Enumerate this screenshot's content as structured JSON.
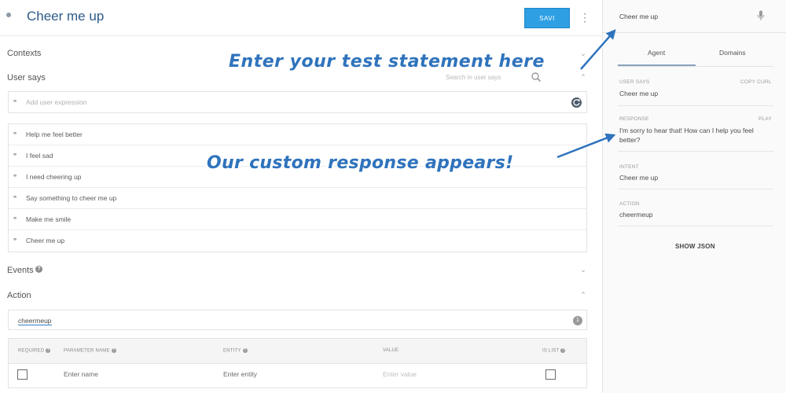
{
  "header": {
    "title": "Cheer me up",
    "save_label": "SAVI"
  },
  "contexts": {
    "title": "Contexts"
  },
  "user_says": {
    "title": "User says",
    "search_placeholder": "Search in user says",
    "add_placeholder": "Add user expression",
    "expressions": [
      "Help me feel better",
      "I feel sad",
      "I need cheering up",
      "Say something to cheer me up",
      "Make me smile",
      "Cheer me up"
    ]
  },
  "events": {
    "title": "Events"
  },
  "action": {
    "title": "Action",
    "value": "cheermeup",
    "count": "1"
  },
  "parameters": {
    "headers": {
      "required": "REQUIRED",
      "name": "PARAMETER NAME",
      "entity": "ENTITY",
      "value": "VALUE",
      "is_list": "IS LIST"
    },
    "row": {
      "name_placeholder": "Enter name",
      "entity_placeholder": "Enter entity",
      "value_placeholder": "Enter value"
    }
  },
  "console": {
    "query": "Cheer me up",
    "tabs": [
      "Agent",
      "Domains"
    ],
    "active_tab": "Agent",
    "user_says_label": "USER SAYS",
    "copy_curl": "COPY CURL",
    "user_says_value": "Cheer me up",
    "response_label": "RESPONSE",
    "play": "PLAY",
    "response_line1": "I'm sorry to hear that! How can I help you feel",
    "response_line2": "better?",
    "intent_label": "INTENT",
    "intent_value": "Cheer me up",
    "action_label": "ACTION",
    "action_value": "cheermeup",
    "show_json": "SHOW JSON"
  },
  "annotations": {
    "test_statement": "Enter your test statement here",
    "custom_response": "Our custom response appears!"
  },
  "colors": {
    "accent": "#2e9fe3",
    "title": "#2d5b8a",
    "annotation": "#2f73bc"
  },
  "icons": [
    "dot-icon",
    "kebab-icon",
    "search-icon",
    "quote-icon",
    "refresh-icon",
    "help-icon",
    "chevron-icon",
    "mic-icon",
    "checkbox-icon"
  ]
}
